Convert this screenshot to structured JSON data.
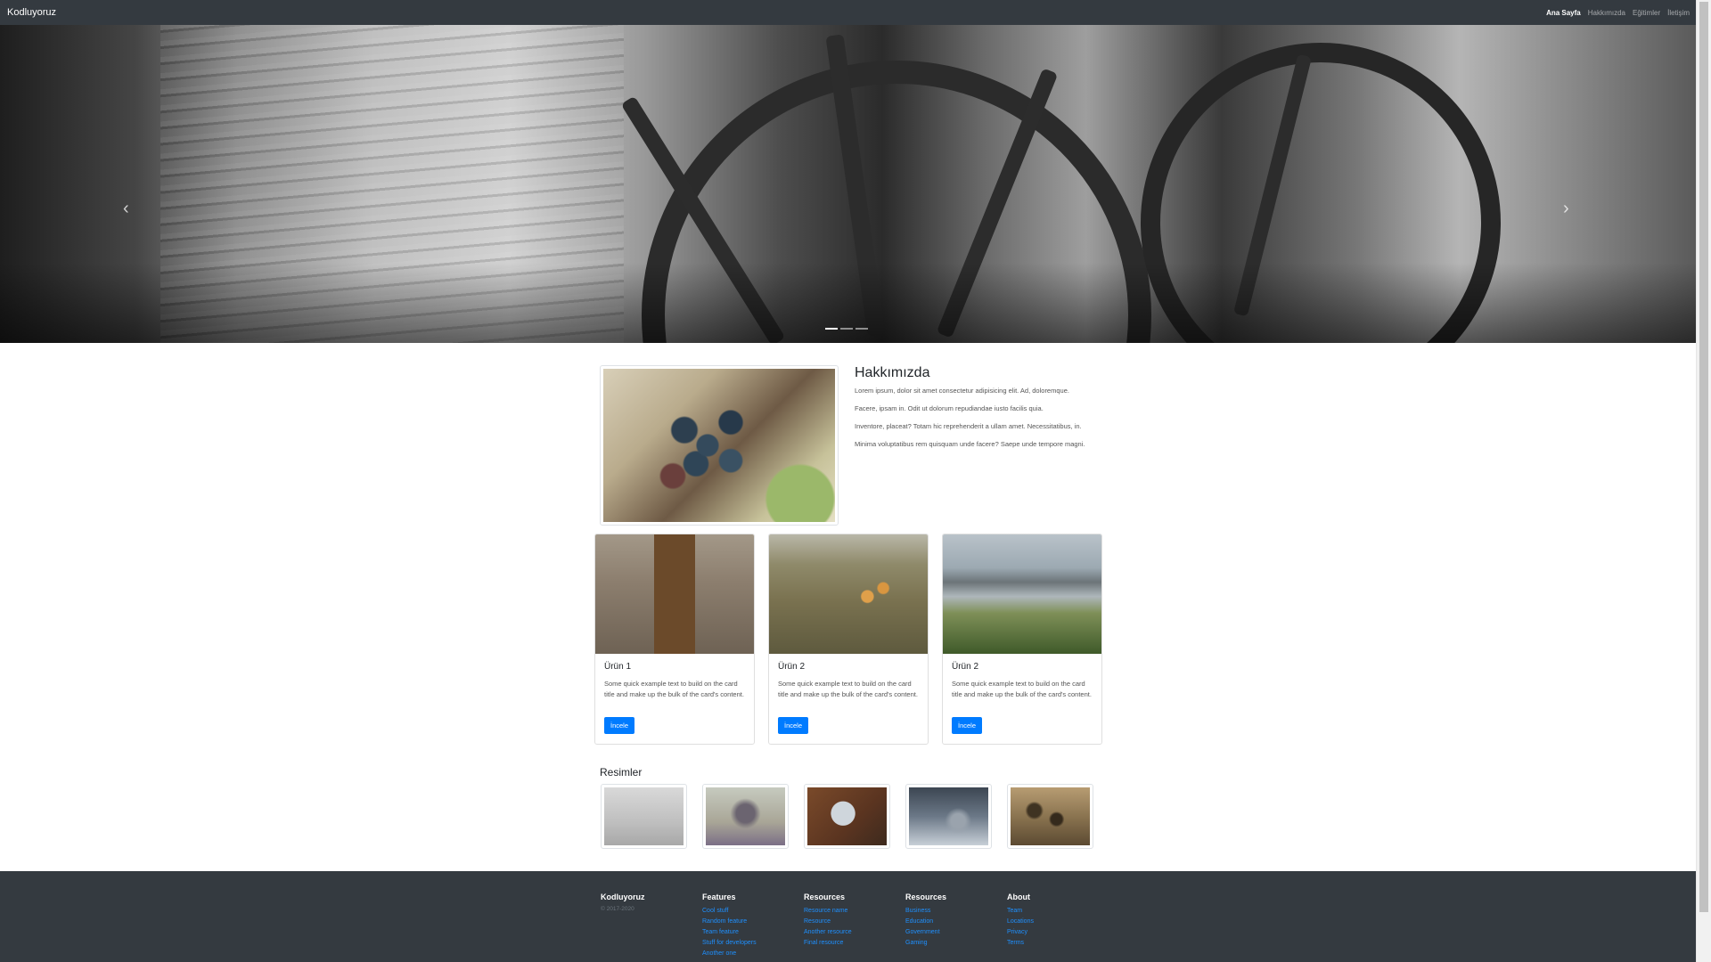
{
  "navbar": {
    "brand": "Kodluyoruz",
    "links": [
      {
        "label": "Ana Sayfa",
        "active": true
      },
      {
        "label": "Hakkımızda",
        "active": false
      },
      {
        "label": "Eğitimler",
        "active": false
      },
      {
        "label": "İletişim",
        "active": false
      }
    ]
  },
  "carousel": {
    "prev_icon": "chevron-left-icon",
    "next_icon": "chevron-right-icon",
    "slide_count": 3,
    "active_slide": 1
  },
  "about": {
    "title": "Hakkımızda",
    "paragraphs": [
      "Lorem ipsum, dolor sit amet consectetur adipisicing elit. Ad, doloremque.",
      "Facere, ipsam in. Odit ut dolorum repudiandae iusto facilis quia.",
      "Inventore, placeat? Totam hic reprehenderit a ullam amet. Necessitatibus, in.",
      "Minima voluptatibus rem quisquam unde facere? Saepe unde tempore magni."
    ]
  },
  "cards": [
    {
      "title": "Ürün 1",
      "text": "Some quick example text to build on the card title and make up the bulk of the card's content.",
      "button": "İncele"
    },
    {
      "title": "Ürün 2",
      "text": "Some quick example text to build on the card title and make up the bulk of the card's content.",
      "button": "İncele"
    },
    {
      "title": "Ürün 2",
      "text": "Some quick example text to build on the card title and make up the bulk of the card's content.",
      "button": "İncele"
    }
  ],
  "gallery": {
    "title": "Resimler",
    "images": [
      "sea-bird",
      "winter-tree",
      "laptop-desk",
      "phone-blur",
      "trees-field"
    ]
  },
  "footer": {
    "brand": "Kodluyoruz",
    "copyright": "© 2017-2020",
    "columns": [
      {
        "title": "Features",
        "links": [
          "Cool stuff",
          "Random feature",
          "Team feature",
          "Stuff for developers",
          "Another one"
        ]
      },
      {
        "title": "Resources",
        "links": [
          "Resource name",
          "Resource",
          "Another resource",
          "Final resource"
        ]
      },
      {
        "title": "Resources",
        "links": [
          "Business",
          "Education",
          "Government",
          "Gaming"
        ]
      },
      {
        "title": "About",
        "links": [
          "Team",
          "Locations",
          "Privacy",
          "Terms"
        ]
      }
    ]
  },
  "colors": {
    "navbar_bg": "#343a40",
    "primary": "#007bff",
    "link": "#1e90ff"
  }
}
